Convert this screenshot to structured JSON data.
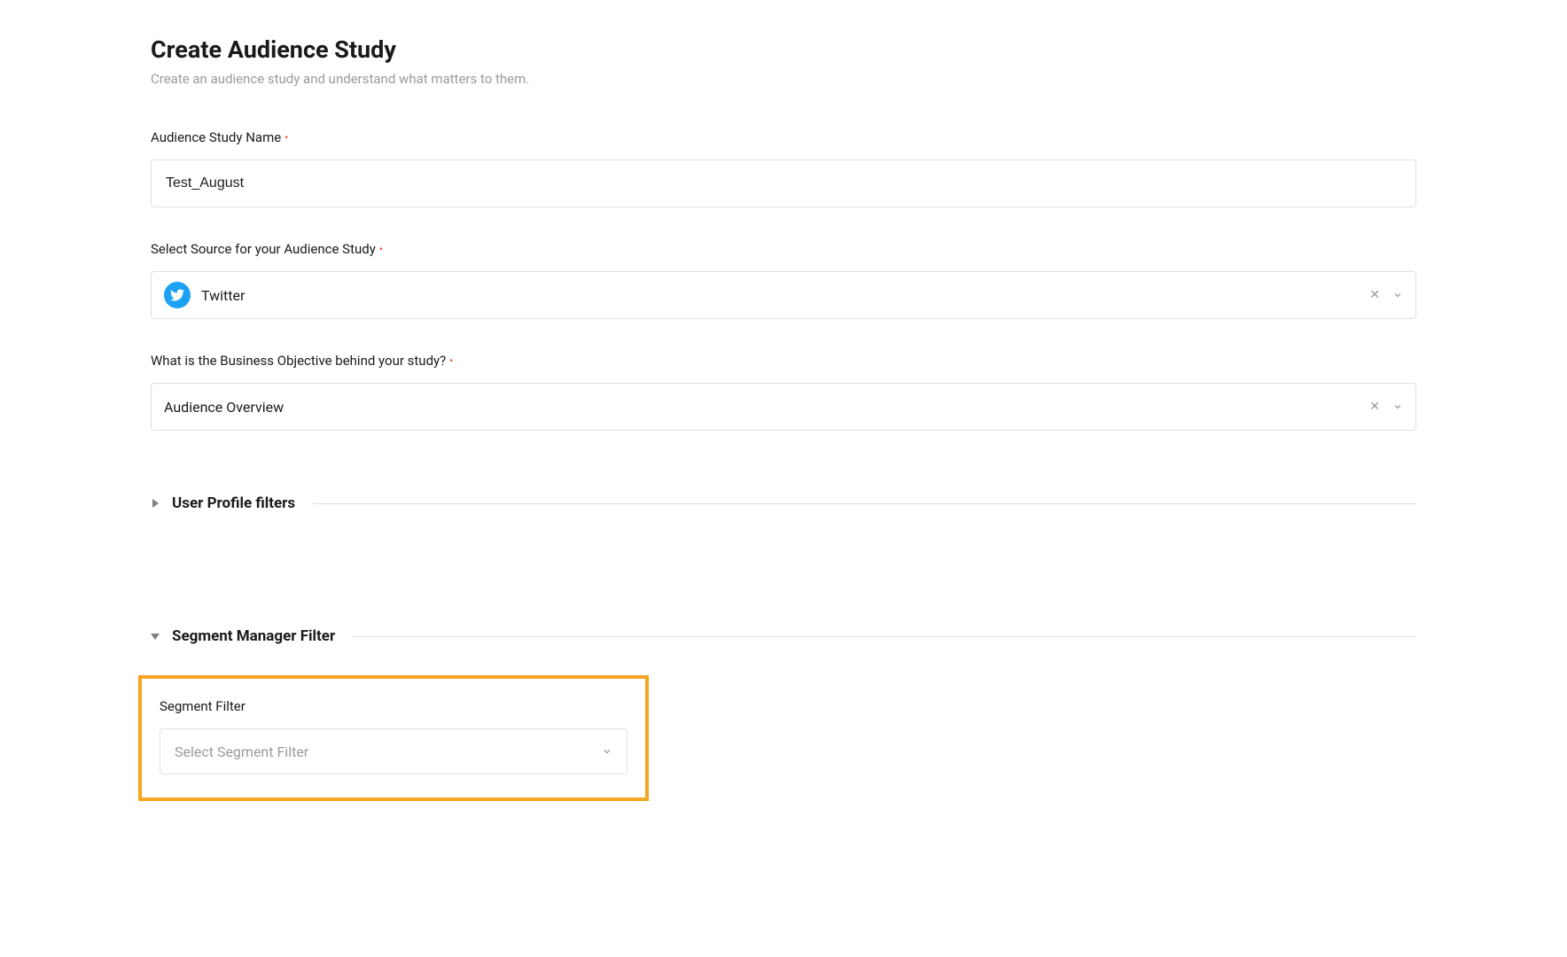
{
  "page": {
    "title": "Create Audience Study",
    "subtitle": "Create an audience study and understand what matters to them."
  },
  "fields": {
    "studyName": {
      "label": "Audience Study Name",
      "value": "Test_August"
    },
    "source": {
      "label": "Select Source for your Audience Study",
      "value": "Twitter"
    },
    "objective": {
      "label": "What is the Business Objective behind your study?",
      "value": "Audience Overview"
    }
  },
  "sections": {
    "userProfile": {
      "title": "User Profile filters"
    },
    "segmentManager": {
      "title": "Segment Manager Filter"
    }
  },
  "segmentFilter": {
    "label": "Segment Filter",
    "placeholder": "Select Segment Filter"
  }
}
